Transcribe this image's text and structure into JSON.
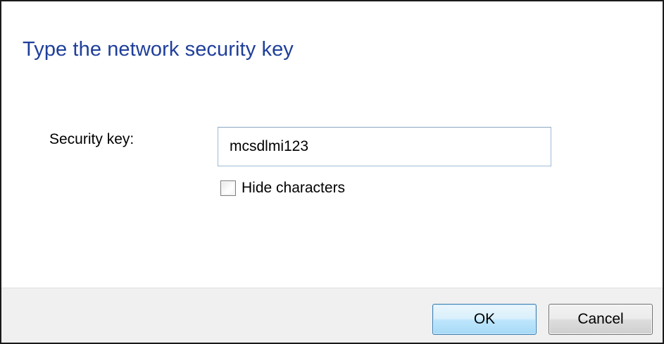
{
  "dialog": {
    "title": "Type the network security key",
    "security_key": {
      "label": "Security key:",
      "value": "mcsdlmi123"
    },
    "hide_characters": {
      "label": "Hide characters",
      "checked": false
    },
    "buttons": {
      "ok": "OK",
      "cancel": "Cancel"
    }
  },
  "colors": {
    "title": "#1f3f9a",
    "footer": "#f0f0f0",
    "ok_border": "#3c7fb1",
    "input_border": "#9dbbd6"
  }
}
